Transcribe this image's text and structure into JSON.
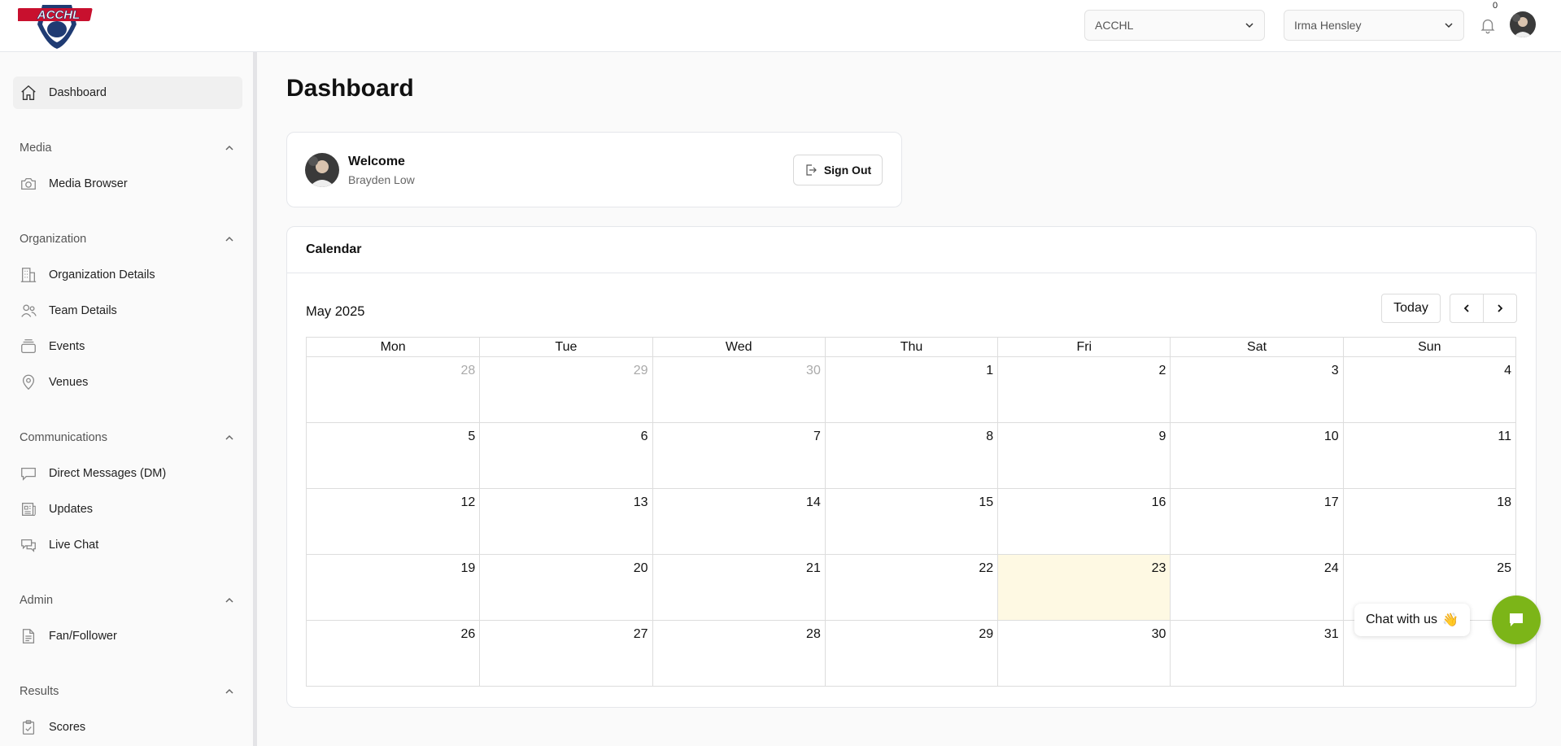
{
  "header": {
    "logo_text": "ACCHL",
    "org_select": {
      "value": "ACCHL",
      "icon": "chevron-down-icon"
    },
    "user_select": {
      "value": "Irma Hensley",
      "icon": "chevron-down-icon"
    },
    "notifications": {
      "count": "0",
      "icon": "bell-icon"
    }
  },
  "sidebar": {
    "dashboard": {
      "label": "Dashboard",
      "icon": "home-icon"
    },
    "sections": [
      {
        "title": "Media",
        "items": [
          {
            "label": "Media Browser",
            "icon": "camera-icon"
          }
        ]
      },
      {
        "title": "Organization",
        "items": [
          {
            "label": "Organization Details",
            "icon": "building-icon"
          },
          {
            "label": "Team Details",
            "icon": "users-icon"
          },
          {
            "label": "Events",
            "icon": "stack-icon"
          },
          {
            "label": "Venues",
            "icon": "map-pin-icon"
          }
        ]
      },
      {
        "title": "Communications",
        "items": [
          {
            "label": "Direct Messages (DM)",
            "icon": "message-icon"
          },
          {
            "label": "Updates",
            "icon": "newspaper-icon"
          },
          {
            "label": "Live Chat",
            "icon": "chat-icon"
          }
        ]
      },
      {
        "title": "Admin",
        "items": [
          {
            "label": "Fan/Follower",
            "icon": "document-icon"
          }
        ]
      },
      {
        "title": "Results",
        "items": [
          {
            "label": "Scores",
            "icon": "clipboard-icon"
          }
        ]
      }
    ]
  },
  "main": {
    "title": "Dashboard",
    "welcome": {
      "label": "Welcome",
      "name": "Brayden Low",
      "signout_label": "Sign Out"
    },
    "calendar": {
      "title": "Calendar",
      "month": "May 2025",
      "today_label": "Today",
      "days_of_week": [
        "Mon",
        "Tue",
        "Wed",
        "Thu",
        "Fri",
        "Sat",
        "Sun"
      ],
      "weeks": [
        [
          "28",
          "29",
          "30",
          "1",
          "2",
          "3",
          "4"
        ],
        [
          "5",
          "6",
          "7",
          "8",
          "9",
          "10",
          "11"
        ],
        [
          "12",
          "13",
          "14",
          "15",
          "16",
          "17",
          "18"
        ],
        [
          "19",
          "20",
          "21",
          "22",
          "23",
          "24",
          "25"
        ],
        [
          "26",
          "27",
          "28",
          "29",
          "30",
          "31",
          ""
        ]
      ]
    }
  },
  "chat_widget": {
    "label": "Chat with us",
    "emoji": "👋"
  },
  "colors": {
    "accent_green": "#7cb518",
    "today_highlight": "#fef9e3"
  }
}
